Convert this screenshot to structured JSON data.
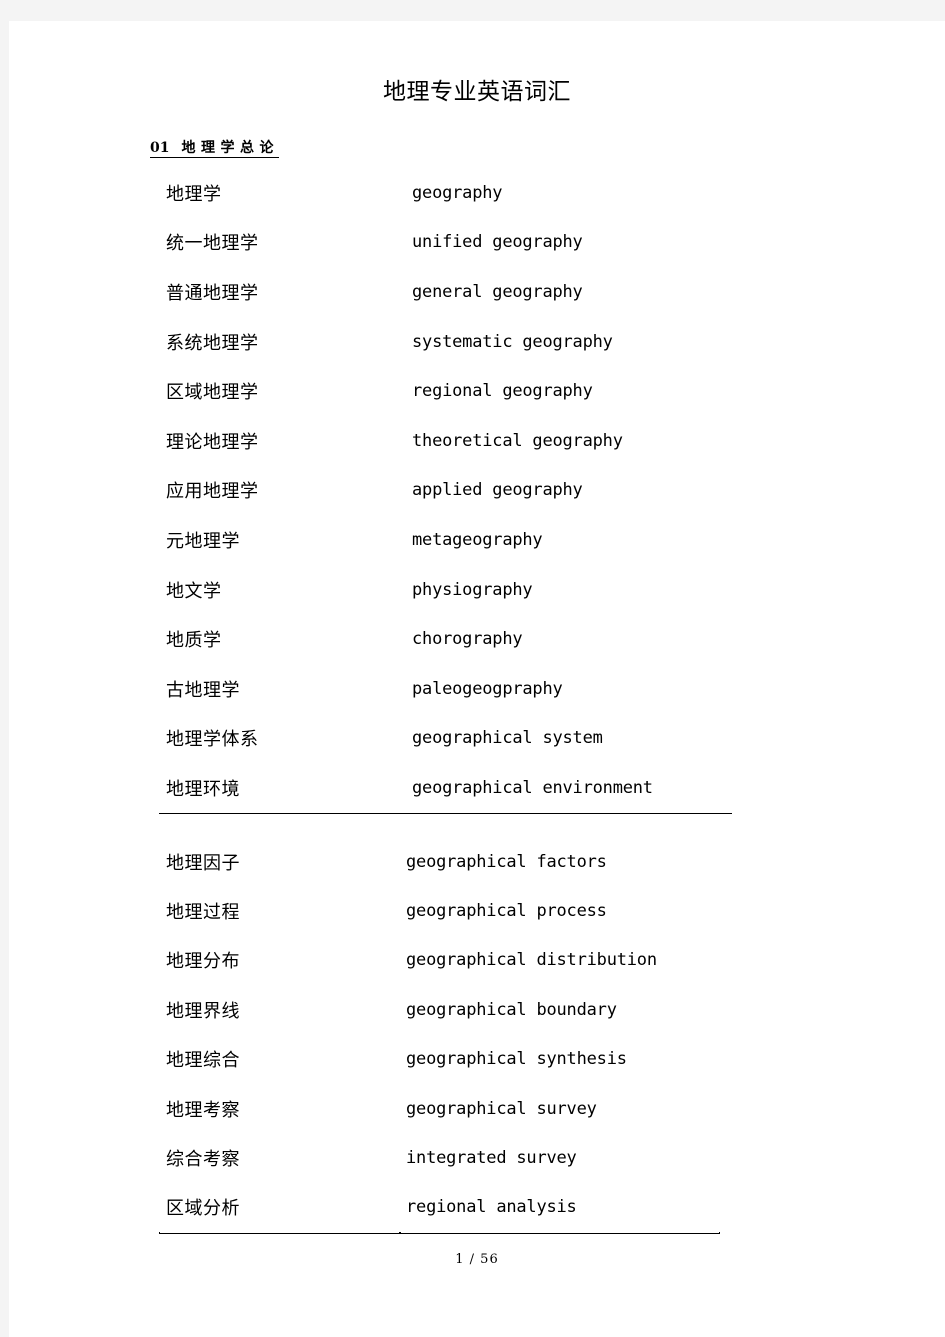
{
  "document": {
    "title": "地理专业英语词汇",
    "page_footer": "1 / 56"
  },
  "section": {
    "number": "01",
    "title": "地理学总论"
  },
  "tables": [
    {
      "id": "table1",
      "rows": [
        {
          "cn": "地理学",
          "en": "geography"
        },
        {
          "cn": "统一地理学",
          "en": "unified geography"
        },
        {
          "cn": "普通地理学",
          "en": "general geography"
        },
        {
          "cn": "系统地理学",
          "en": "systematic geography"
        },
        {
          "cn": "区域地理学",
          "en": "regional geography"
        },
        {
          "cn": "理论地理学",
          "en": "theoretical geography"
        },
        {
          "cn": "应用地理学",
          "en": "applied geography"
        },
        {
          "cn": "元地理学",
          "en": "metageography"
        },
        {
          "cn": "地文学",
          "en": "physiography"
        },
        {
          "cn": "地质学",
          "en": "chorography"
        },
        {
          "cn": "古地理学",
          "en": "paleogeogpraphy"
        },
        {
          "cn": "地理学体系",
          "en": "geographical system"
        },
        {
          "cn": "地理环境",
          "en": "geographical environment"
        }
      ]
    },
    {
      "id": "table2",
      "rows": [
        {
          "cn": "地理因子",
          "en": "geographical factors"
        },
        {
          "cn": "地理过程",
          "en": "geographical process"
        },
        {
          "cn": "地理分布",
          "en": "geographical distribution"
        },
        {
          "cn": "地理界线",
          "en": "geographical boundary"
        },
        {
          "cn": "地理综合",
          "en": "geographical synthesis"
        },
        {
          "cn": "地理考察",
          "en": "geographical survey"
        },
        {
          "cn": "综合考察",
          "en": "integrated survey"
        },
        {
          "cn": "区域分析",
          "en": "regional analysis"
        }
      ]
    }
  ]
}
